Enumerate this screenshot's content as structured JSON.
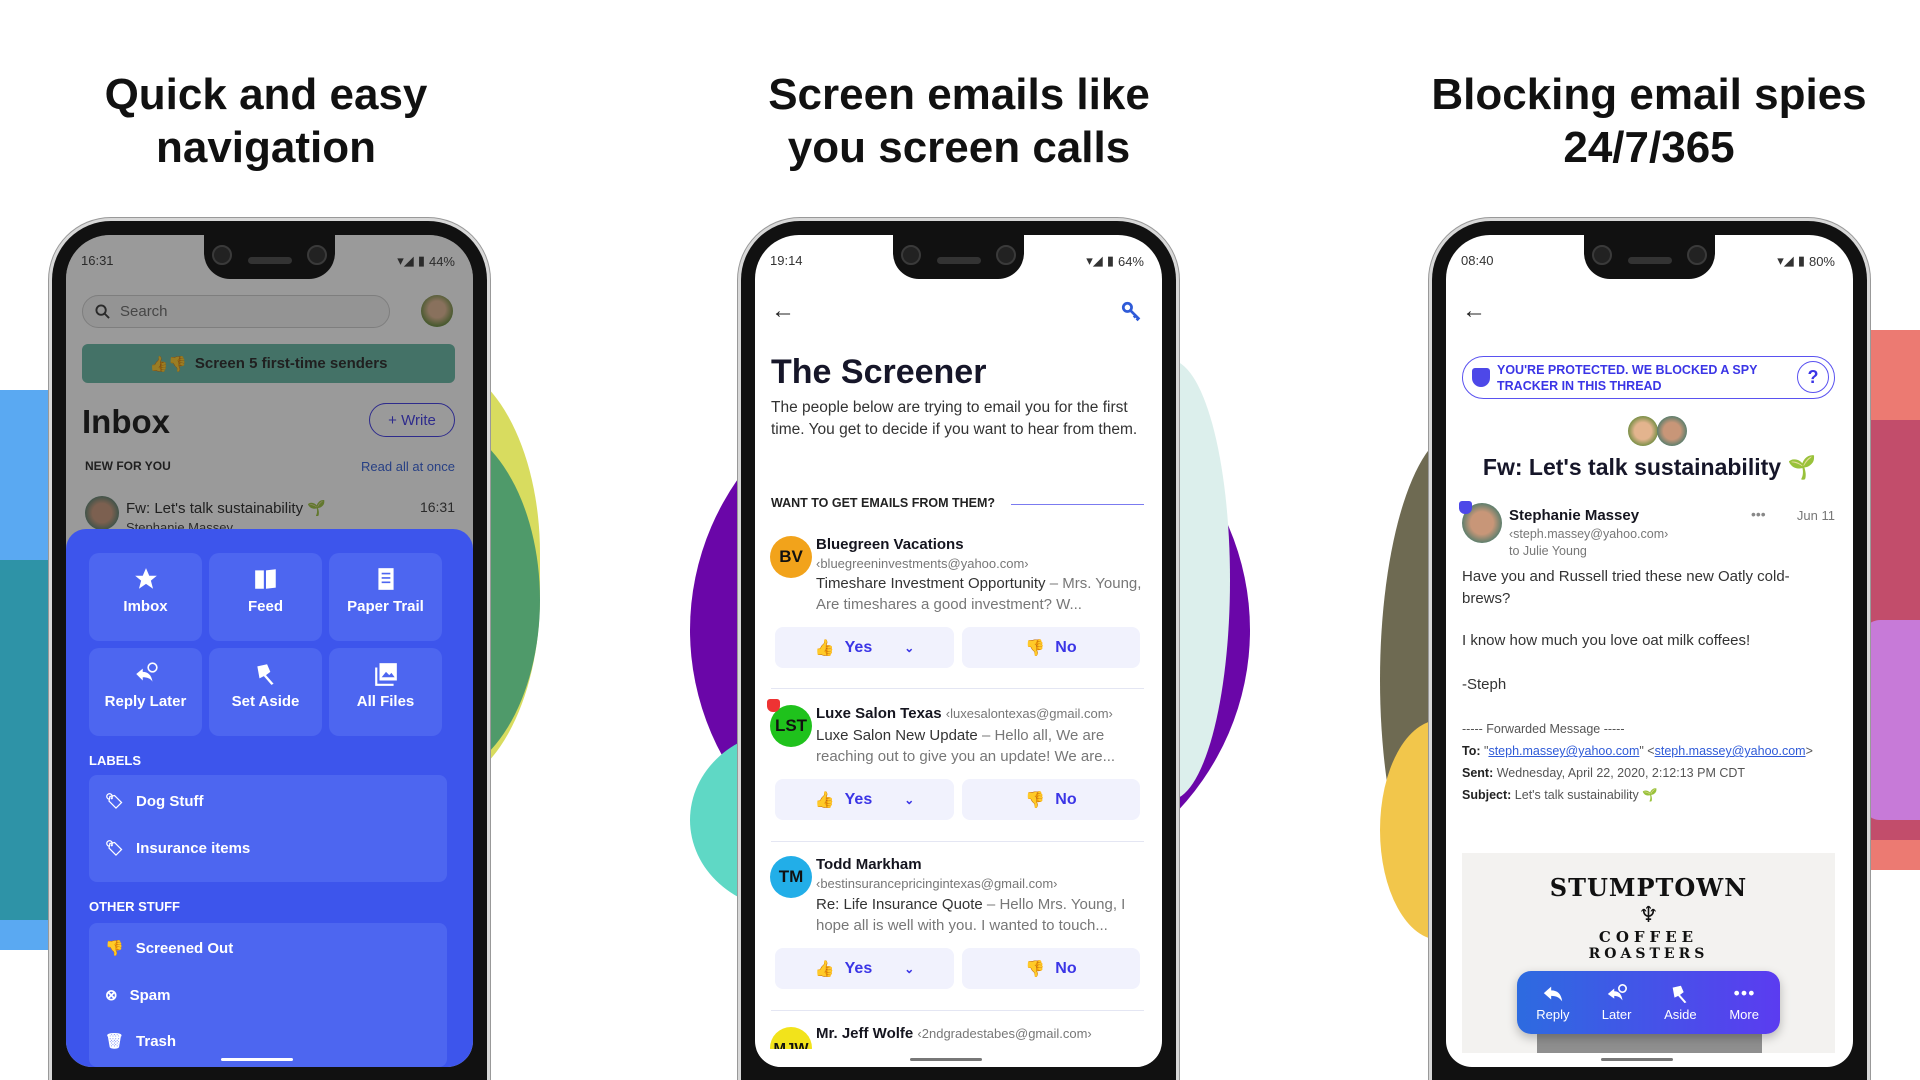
{
  "headings": [
    {
      "line1": "Quick and easy",
      "line2": "navigation"
    },
    {
      "line1": "Screen emails like",
      "line2": "you screen calls"
    },
    {
      "line1": "Blocking email spies",
      "line2": "24/7/365"
    }
  ],
  "colors": {
    "menu_sheet": "#3d55ec",
    "accent": "#3b35e6",
    "screen_banner": "#4f8e7d",
    "action_bar_start": "#2d6be0",
    "action_bar_end": "#5b3cf0"
  },
  "left_phone": {
    "status": {
      "time": "16:31",
      "battery": "44%"
    },
    "search": {
      "placeholder": "Search",
      "icon": "search-icon"
    },
    "screen_banner": "Screen 5 first-time senders",
    "inbox_title": "Inbox",
    "write_button": "+ Write",
    "new_for_you": "NEW FOR YOU",
    "read_all": "Read all at once",
    "email": {
      "subject": "Fw: Let's talk sustainability 🌱",
      "sender": "Stephanie Massey",
      "time": "16:31"
    },
    "menu_tiles": [
      {
        "label": "Imbox",
        "icon": "star-icon"
      },
      {
        "label": "Feed",
        "icon": "book-icon"
      },
      {
        "label": "Paper Trail",
        "icon": "receipt-icon"
      },
      {
        "label": "Reply Later",
        "icon": "reply-clock-icon"
      },
      {
        "label": "Set Aside",
        "icon": "pin-icon"
      },
      {
        "label": "All Files",
        "icon": "images-icon"
      }
    ],
    "labels_header": "LABELS",
    "labels": [
      {
        "label": "Dog Stuff",
        "icon": "tag-icon"
      },
      {
        "label": "Insurance items",
        "icon": "tag-icon"
      }
    ],
    "other_header": "OTHER STUFF",
    "other": [
      {
        "label": "Screened Out",
        "icon": "thumbs-down-icon"
      },
      {
        "label": "Spam",
        "icon": "spam-icon"
      },
      {
        "label": "Trash",
        "icon": "trash-icon"
      }
    ]
  },
  "middle_phone": {
    "status": {
      "time": "19:14",
      "battery": "64%"
    },
    "title": "The Screener",
    "intro": "The people below are trying to email you for the first time. You get to decide if you want to hear from them.",
    "section": "WANT TO GET EMAILS FROM THEM?",
    "yes_label": "Yes",
    "no_label": "No",
    "senders": [
      {
        "initials": "BV",
        "color": "#f2a31b",
        "name": "Bluegreen Vacations",
        "email": "‹bluegreeninvestments@yahoo.com›",
        "subject": "Timeshare Investment Opportunity",
        "preview": " – Mrs. Young, Are timeshares a good investment? W..."
      },
      {
        "initials": "LST",
        "color": "#1fc21c",
        "name": "Luxe Salon Texas",
        "email": "‹luxesalontexas@gmail.com›",
        "subject": "Luxe Salon New Update",
        "preview": " – Hello all, We are reaching out to give you an update! We are..."
      },
      {
        "initials": "TM",
        "color": "#22aee8",
        "name": "Todd Markham",
        "email": "‹bestinsurancepricingintexas@gmail.com›",
        "subject": "Re: Life Insurance Quote",
        "preview": " – Hello Mrs. Young, I hope all is well with you. I wanted to touch..."
      },
      {
        "initials": "MJW",
        "color": "#f2e31b",
        "name": "Mr. Jeff Wolfe",
        "email": "‹2ndgradestabes@gmail.com›"
      }
    ]
  },
  "right_phone": {
    "status": {
      "time": "08:40",
      "battery": "80%"
    },
    "banner": "YOU'RE PROTECTED. WE BLOCKED A SPY TRACKER IN THIS THREAD",
    "help": "?",
    "title": "Fw: Let's talk sustainability 🌱",
    "sender": {
      "name": "Stephanie Massey",
      "email": "‹steph.massey@yahoo.com›",
      "to": "to Julie Young",
      "date": "Jun 11"
    },
    "body": [
      "Have you and Russell tried these new Oatly cold-brews?",
      "I know how much you love oat milk coffees!",
      "-Steph"
    ],
    "forwarded": "----- Forwarded Message -----",
    "to_label": "To:",
    "to_name": "steph.massey@yahoo.com",
    "to_email": "steph.massey@yahoo.com",
    "sent_label": "Sent:",
    "sent_value": "Wednesday, April 22, 2020, 2:12:13 PM CDT",
    "subject_label": "Subject:",
    "subject_value": "Let's talk sustainability 🌱",
    "logo": {
      "top": "STUMPTOWN",
      "middle": "COFFEE",
      "bottom": "ROASTERS"
    },
    "actions": [
      {
        "label": "Reply",
        "icon": "reply-icon"
      },
      {
        "label": "Later",
        "icon": "reply-clock-icon"
      },
      {
        "label": "Aside",
        "icon": "pin-icon"
      },
      {
        "label": "More",
        "icon": "more-icon"
      }
    ]
  }
}
